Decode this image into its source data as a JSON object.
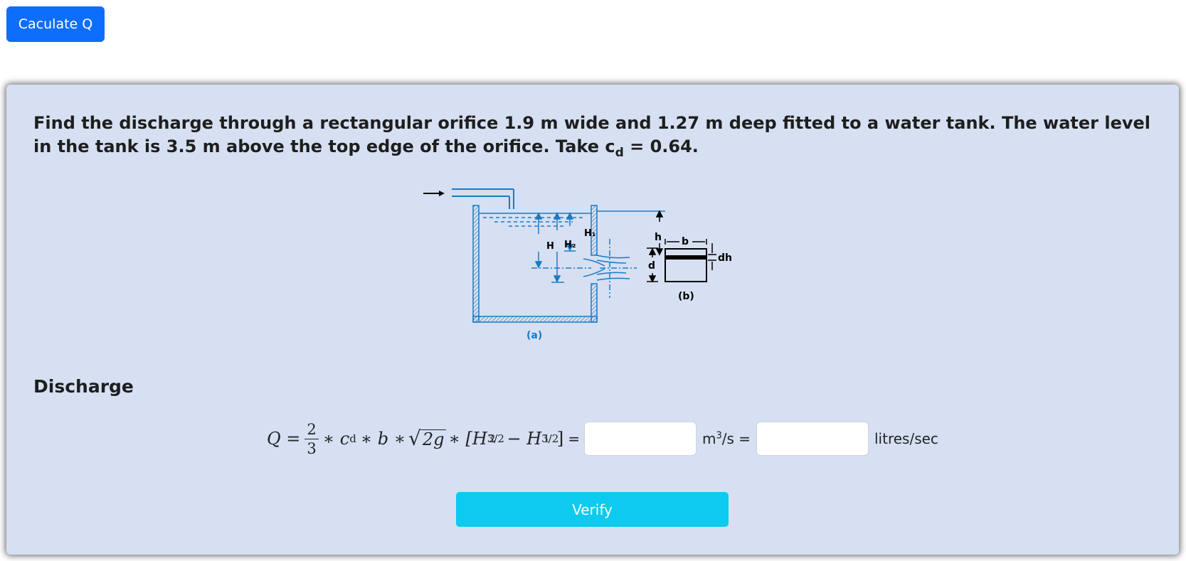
{
  "header": {
    "calc_button_label": "Caculate Q"
  },
  "problem": {
    "text_before": "Find the discharge through a rectangular orifice 1.9 m wide and 1.27 m deep fitted to a water tank. The water level in the tank is 3.5 m above the top edge of the orifice. Take c",
    "subscript": "d",
    "text_after": " = 0.64."
  },
  "diagram": {
    "label_a": "(a)",
    "label_b": "(b)",
    "label_H": "H",
    "label_H1": "H₁",
    "label_H2": "H₂",
    "label_h": "h",
    "label_b_dim": "b",
    "label_d": "d",
    "label_dh": "dh"
  },
  "section": {
    "title": "Discharge"
  },
  "formula": {
    "lhs": "Q =",
    "frac_num": "2",
    "frac_den": "3",
    "terms_mid": "∗ c",
    "cd_sub": "d",
    "terms_b": "∗ b ∗",
    "sqrt_arg": "2g",
    "bracket_part": "∗ [H",
    "h2_sub": "2",
    "h_exp": "3/2",
    "minus_part": "− H",
    "h1_sub": "1",
    "close": "]",
    "equals": "=",
    "input1_value": "",
    "unit1_base": "m",
    "unit1_sup": "3",
    "unit1_tail": "/s =",
    "input2_value": "",
    "unit2": "litres/sec"
  },
  "actions": {
    "verify_label": "Verify"
  },
  "colors": {
    "primary": "#0d6efd",
    "info": "#0dcaf0",
    "card_bg": "#d6e0f2",
    "diagram_blue": "#1a7ac4"
  }
}
